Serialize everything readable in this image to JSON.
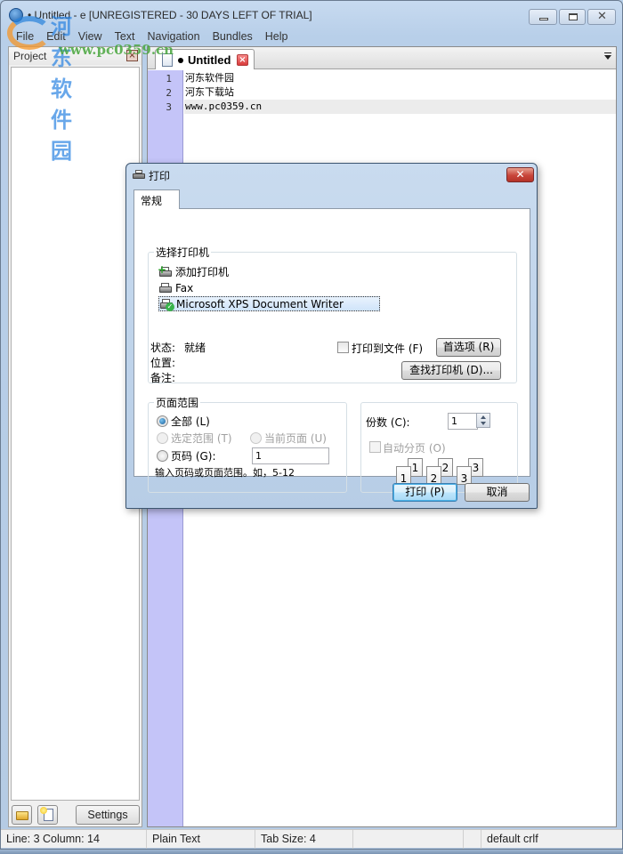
{
  "window": {
    "title": "• Untitled - e  [UNREGISTERED - 30 DAYS LEFT OF TRIAL]",
    "controls": {
      "minimize": "minimize",
      "maximize": "maximize",
      "close": "✕"
    }
  },
  "menu": [
    "File",
    "Edit",
    "View",
    "Text",
    "Navigation",
    "Bundles",
    "Help"
  ],
  "project_panel": {
    "title": "Project",
    "close_glyph": "×",
    "settings_label": "Settings"
  },
  "editor": {
    "tab": {
      "title": "Untitled",
      "modified": true,
      "close_glyph": "×"
    },
    "lines": [
      {
        "num": "1",
        "text": "河东软件园"
      },
      {
        "num": "2",
        "text": "河东下载站"
      },
      {
        "num": "3",
        "text": "www.pc0359.cn"
      }
    ]
  },
  "status_bar": {
    "position": "Line: 3  Column: 14",
    "syntax": "Plain Text",
    "tab_size": "Tab Size: 4",
    "blank": "",
    "line_endings": "default crlf"
  },
  "watermark": {
    "name": "河东软件园",
    "url": "www.pc0359.cn"
  },
  "print_dialog": {
    "title": "打印",
    "close_glyph": "✕",
    "tab": "常规",
    "select_printer": {
      "label": "选择打印机",
      "printers": [
        {
          "name": "添加打印机",
          "icon": "add-printer"
        },
        {
          "name": "Fax",
          "icon": "printer"
        },
        {
          "name": "Microsoft XPS Document Writer",
          "icon": "default-printer",
          "selected": true
        }
      ],
      "status_label": "状态:",
      "status_value": "就绪",
      "location_label": "位置:",
      "comment_label": "备注:",
      "print_to_file": "打印到文件 (F)",
      "print_to_file_checked": false,
      "preferences": "首选项 (R)",
      "find_printer": "查找打印机 (D)..."
    },
    "page_range": {
      "label": "页面范围",
      "all": "全部 (L)",
      "selection": "选定范围 (T)",
      "current_page": "当前页面 (U)",
      "pages": "页码 (G):",
      "pages_value": "1",
      "hint": "输入页码或页面范围。如，5-12",
      "selected": "all"
    },
    "copies": {
      "label": "份数 (C):",
      "value": "1",
      "collate": "自动分页 (O)",
      "collate_checked": false,
      "collate_pages": [
        "1",
        "2",
        "3"
      ]
    },
    "buttons": {
      "print": "打印 (P)",
      "cancel": "取消"
    }
  }
}
